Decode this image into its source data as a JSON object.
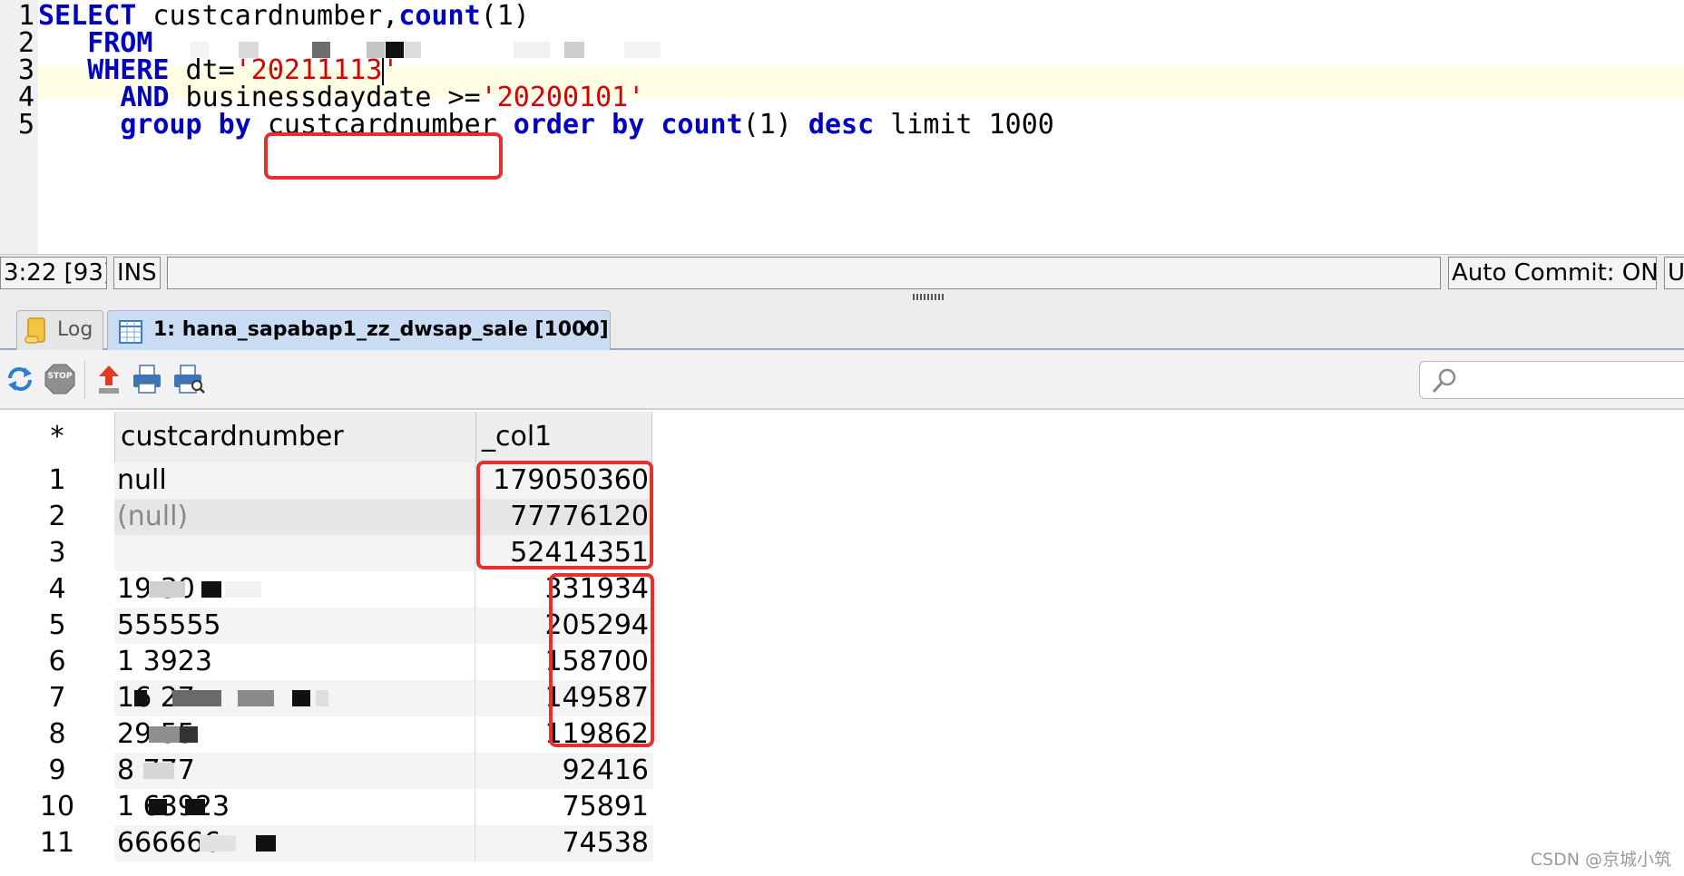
{
  "editor": {
    "line_numbers": [
      "1",
      "2",
      "3",
      "4",
      "5"
    ],
    "line1": {
      "kw1": "SELECT",
      "t1": " custcardnumber,",
      "kw2": "count",
      "t2": "(1)"
    },
    "line2": {
      "kw1": "FROM"
    },
    "line3": {
      "kw1": "WHERE",
      "t1": " dt=",
      "str1": "'20211113",
      "str2": "'"
    },
    "line4": {
      "kw1": "AND",
      "t1": " businessdaydate >=",
      "str1": "'20200101'"
    },
    "line5": {
      "kw1": "group by",
      "t1": " custcardnumber ",
      "kw2": "order by",
      "t2": " ",
      "kw3": "count",
      "t3": "(1) ",
      "kw4": "desc",
      "t4": " limit 1000"
    }
  },
  "status": {
    "position": "3:22 [93]",
    "mode": "INS",
    "message": "",
    "auto_commit": "Auto Commit: ON",
    "encoding": "U"
  },
  "tabs": [
    {
      "label": "Log",
      "icon": "log-scroll-icon"
    },
    {
      "label": "1: hana_sapabap1_zz_dwsap_sale [1000]",
      "icon": "table-grid-icon",
      "close": "✕"
    }
  ],
  "toolbar": {
    "buttons": [
      "refresh-icon",
      "stop-icon",
      "export-icon",
      "print-icon",
      "print-preview-icon"
    ],
    "stop_label": "STOP",
    "search_placeholder": ""
  },
  "grid": {
    "corner": "*",
    "columns": [
      "custcardnumber",
      "_col1"
    ],
    "rows": [
      {
        "n": "1",
        "card": "null",
        "col1": "179050360"
      },
      {
        "n": "2",
        "card": "(null)",
        "col1": "77776120"
      },
      {
        "n": "3",
        "card": "",
        "col1": "52414351"
      },
      {
        "n": "4",
        "card": "19            30",
        "col1": "331934"
      },
      {
        "n": "5",
        "card": "555555",
        "col1": "205294"
      },
      {
        "n": "6",
        "card": "1                        3923",
        "col1": "158700"
      },
      {
        "n": "7",
        "card": "16        27",
        "col1": "149587"
      },
      {
        "n": "8",
        "card": "29     55",
        "col1": "119862"
      },
      {
        "n": "9",
        "card": "8         777",
        "col1": "92416"
      },
      {
        "n": "10",
        "card": "1                      63923",
        "col1": "75891"
      },
      {
        "n": "11",
        "card": "666666",
        "col1": "74538"
      }
    ]
  },
  "colors": {
    "keyword": "#0000c0",
    "string": "#d40000",
    "highlight_box": "#e5302f",
    "tab_active": "#c9dcf3"
  },
  "watermark": "CSDN @京城小筑"
}
